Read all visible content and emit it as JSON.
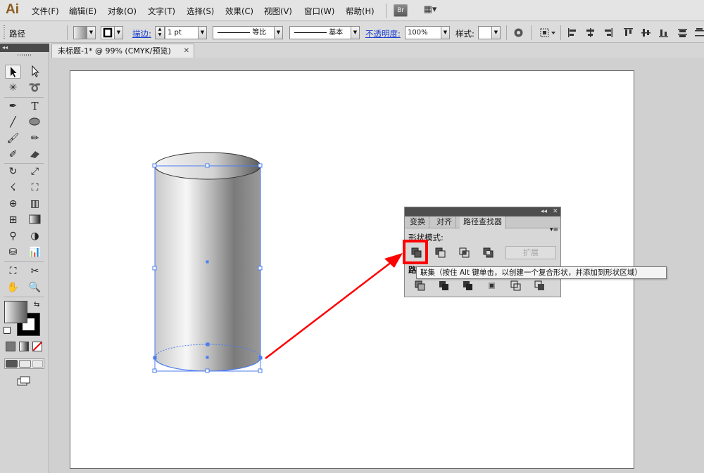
{
  "app": {
    "logo": "Ai"
  },
  "menu": {
    "items": [
      "文件(F)",
      "编辑(E)",
      "对象(O)",
      "文字(T)",
      "选择(S)",
      "效果(C)",
      "视图(V)",
      "窗口(W)",
      "帮助(H)"
    ],
    "bridge_label": "Br",
    "arrange_label": "▦▾"
  },
  "control": {
    "selection_label": "路径",
    "stroke_label": "描边:",
    "stroke_weight": "1 pt",
    "profile_label": "等比",
    "brush_label": "基本",
    "opacity_label": "不透明度:",
    "opacity_value": "100%",
    "style_label": "样式:"
  },
  "tools": {
    "collapse": "◂◂"
  },
  "document": {
    "tab_title": "未标题-1* @ 99% (CMYK/预览)",
    "close": "✕"
  },
  "pathfinder": {
    "collapse": "◂◂",
    "close": "✕",
    "tabs": [
      "变换",
      "对齐",
      "路径查找器"
    ],
    "active_tab": "路径查找器",
    "menu": "▾≡",
    "shape_modes_label": "形状模式:",
    "pathfinders_label": "路",
    "expand_label": "扩展",
    "icons": [
      "unite-icon",
      "minus-front-icon",
      "intersect-icon",
      "exclude-icon",
      "divide-icon",
      "trim-icon",
      "merge-icon",
      "crop-icon",
      "outline-icon",
      "minus-back-icon"
    ]
  },
  "tooltip": {
    "text": "联集（按住 Alt 键单击，以创建一个复合形状，并添加到形状区域）"
  },
  "colors": {
    "annotation": "#ff0000",
    "selection": "#4a7cf0",
    "link": "#1a3fd0"
  }
}
